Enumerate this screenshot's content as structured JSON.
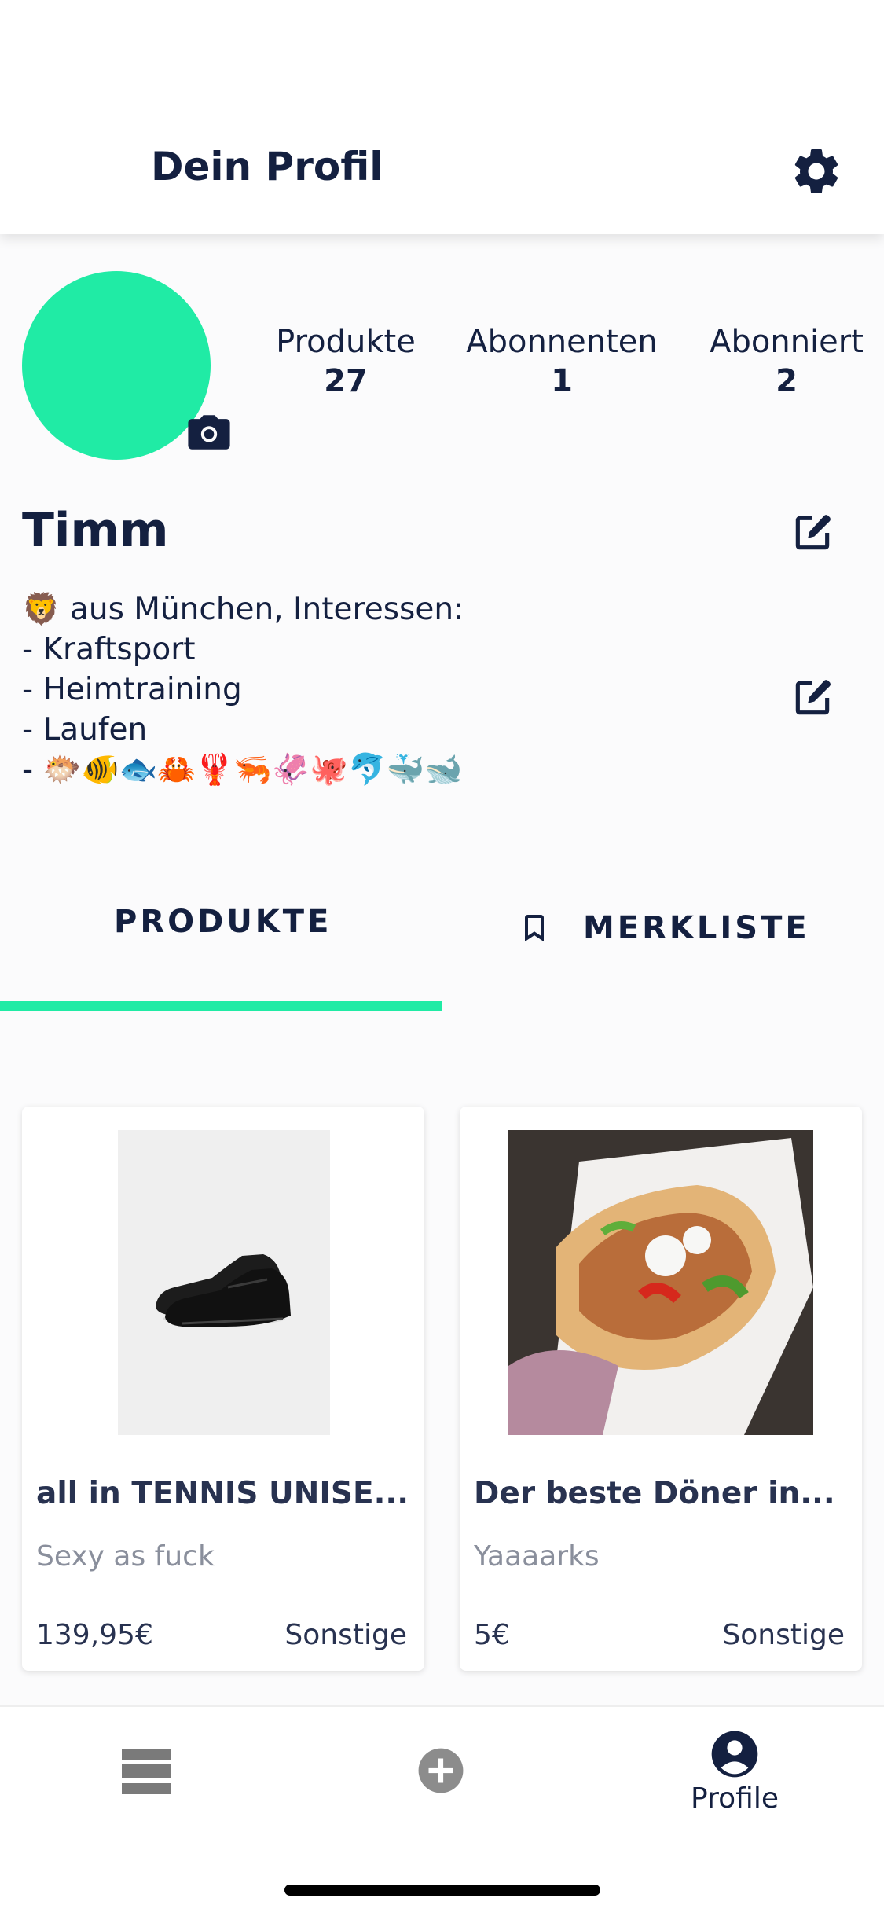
{
  "header": {
    "title": "Dein Profil",
    "settings_icon": "gear-icon"
  },
  "profile": {
    "avatar_color": "#20eba5",
    "stats": [
      {
        "label": "Produkte",
        "value": "27"
      },
      {
        "label": "Abonnenten",
        "value": "1"
      },
      {
        "label": "Abonniert",
        "value": "2"
      }
    ],
    "name": "Timm",
    "bio": "🦁 aus München, Interessen:\n- Kraftsport\n- Heimtraining\n- Laufen\n- 🐡🐠🐟🦀🦞🦐🦑🐙🐬🐳🐋"
  },
  "tabs": [
    {
      "label": "PRODUKTE",
      "active": true
    },
    {
      "label": "MERKLISTE",
      "active": false,
      "icon": "bookmark-icon"
    }
  ],
  "products": [
    {
      "title": "all in TENNIS UNISE...",
      "description": "Sexy as fuck",
      "price": "139,95€",
      "category": "Sonstige",
      "image": "black-sneaker-photo"
    },
    {
      "title": "Der beste Döner in...",
      "description": "Yaaaarks",
      "price": "5€",
      "category": "Sonstige",
      "image": "doner-kebab-photo"
    }
  ],
  "nav": {
    "profile_label": "Profile"
  },
  "colors": {
    "accent": "#20eba5",
    "text": "#142040",
    "muted": "#8a8f9c"
  }
}
